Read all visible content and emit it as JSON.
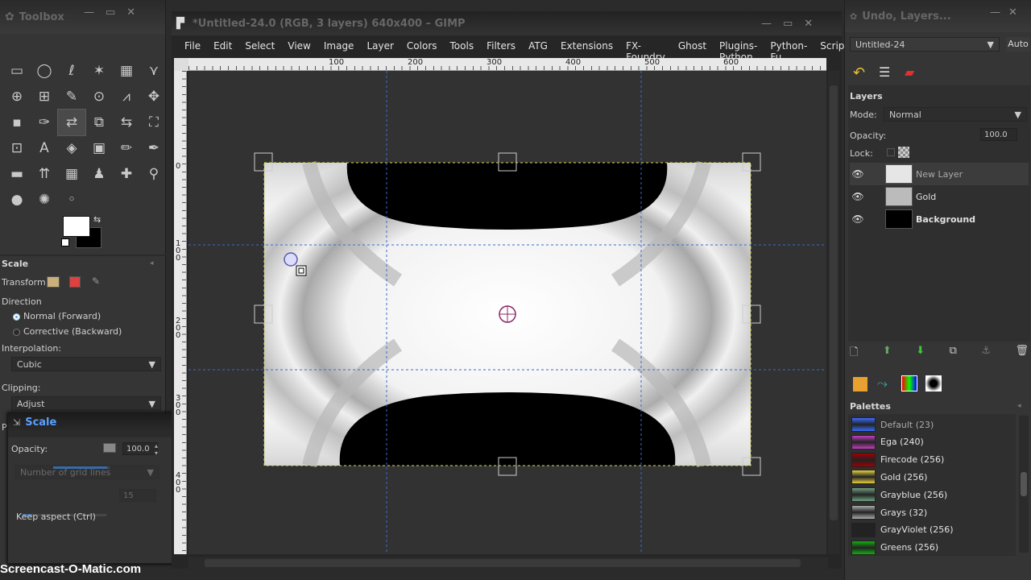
{
  "toolbox": {
    "title": "Toolbox",
    "tools": [
      "▭",
      "◯",
      "ℓ",
      "✶",
      "▦",
      "⋎",
      "⊕",
      "⊞",
      "✎",
      "⊙",
      "⩘",
      "✥",
      "▪",
      "✑",
      "⇄",
      "⧉",
      "⇆",
      "⛶",
      "⊡",
      "A",
      "◈",
      "▣",
      "✏",
      "✒",
      "▬",
      "⇈",
      "▦",
      "♟",
      "✚",
      "⚲",
      "●",
      "✺",
      "◦"
    ],
    "tool_options_title": "Scale",
    "transform_label": "Transform:",
    "direction_label": "Direction",
    "direction_forward": "Normal (Forward)",
    "direction_backward": "Corrective (Backward)",
    "interpolation_label": "Interpolation:",
    "interpolation_value": "Cubic",
    "clipping_label": "Clipping:",
    "clipping_value": "Adjust",
    "p_label": "P"
  },
  "scale_dialog": {
    "title": "Scale",
    "opacity_label": "Opacity:",
    "opacity_value": "100.0",
    "opacity_fraction": 0.95,
    "grid_lines_label": "Number of grid lines",
    "grid_lines_value": "15",
    "keep_aspect_label": "Keep aspect  (Ctrl)"
  },
  "image_window": {
    "title": "*Untitled-24.0 (RGB, 3 layers) 640x400 – GIMP",
    "menus": [
      "File",
      "Edit",
      "Select",
      "View",
      "Image",
      "Layer",
      "Colors",
      "Tools",
      "Filters",
      "ATG",
      "Extensions",
      "FX-Foundry",
      "Ghost",
      "Plugins-Python",
      "Python-Fu",
      "Script"
    ],
    "ruler_h_labels": [
      "100",
      "200",
      "300",
      "400",
      "500",
      "600"
    ],
    "ruler_v_labels": [
      "0",
      "100",
      "200",
      "300",
      "400"
    ]
  },
  "dock": {
    "title": "Undo, Layers...",
    "image_selector": "Untitled-24",
    "auto_label": "Auto",
    "layers_title": "Layers",
    "mode_label": "Mode:",
    "mode_value": "Normal",
    "opacity_label": "Opacity:",
    "opacity_value": "100.0",
    "lock_label": "Lock:",
    "layers": [
      {
        "name": "New Layer",
        "bold": false,
        "thumb": "#e6e6e6"
      },
      {
        "name": "Gold",
        "bold": false,
        "thumb": "#bbbbbb"
      },
      {
        "name": "Background",
        "bold": true,
        "thumb": "#000000"
      }
    ],
    "palettes_title": "Palettes",
    "palettes": [
      {
        "name": "Default (23)",
        "color": "#3a6cff"
      },
      {
        "name": "Ega (240)",
        "color": "#c040c0"
      },
      {
        "name": "Firecode (256)",
        "color": "#a00000"
      },
      {
        "name": "Gold (256)",
        "color": "#e8d040"
      },
      {
        "name": "Grayblue (256)",
        "color": "#70a080"
      },
      {
        "name": "Grays (32)",
        "color": "#aaaaaa"
      },
      {
        "name": "GrayViolet (256)",
        "color": "#222222"
      },
      {
        "name": "Greens (256)",
        "color": "#10b010"
      }
    ]
  },
  "watermark": "Screencast-O-Matic.com"
}
